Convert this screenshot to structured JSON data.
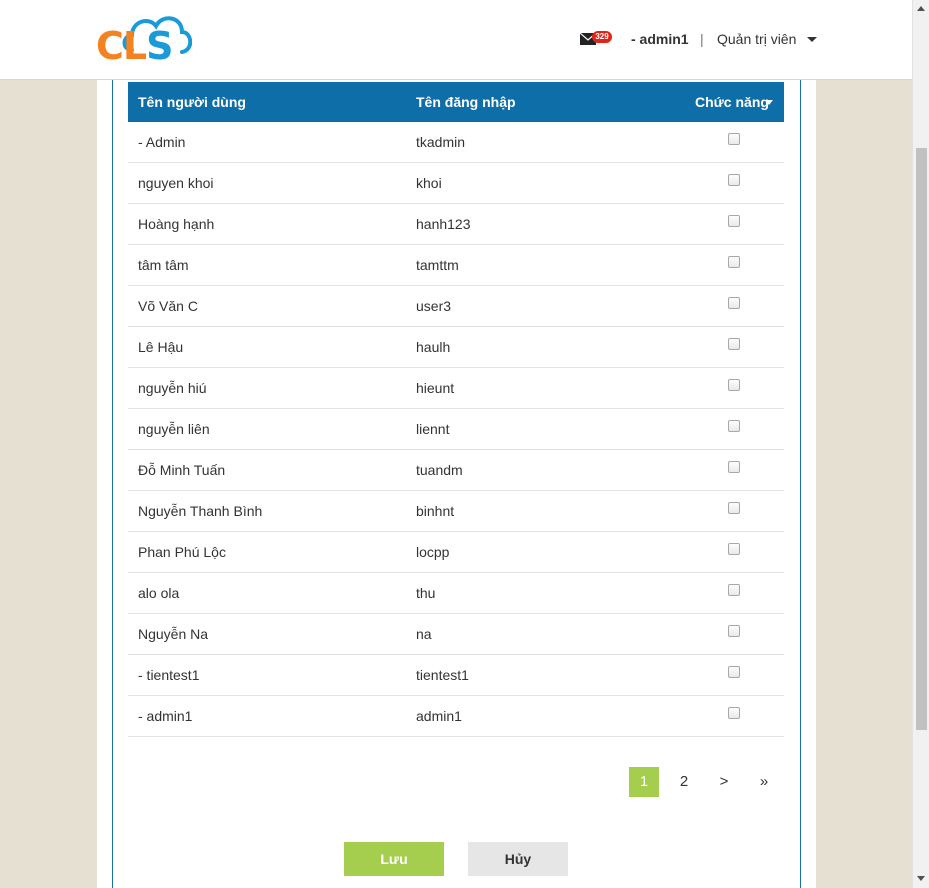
{
  "header": {
    "logo_text_main": "CL",
    "logo_text_accent": "S",
    "mail_icon": "envelope-icon",
    "mail_count": "329",
    "user_name": "- admin1",
    "separator": "|",
    "role": "Quản trị viên"
  },
  "table": {
    "columns": [
      "Tên người dùng",
      "Tên đăng nhập",
      "Chức năng"
    ],
    "rows": [
      {
        "name": "- Admin",
        "login": "tkadmin"
      },
      {
        "name": "nguyen khoi",
        "login": "khoi"
      },
      {
        "name": "Hoàng hạnh",
        "login": "hanh123"
      },
      {
        "name": "tâm tâm",
        "login": "tamttm"
      },
      {
        "name": "Võ Văn C",
        "login": "user3"
      },
      {
        "name": "Lê Hậu",
        "login": "haulh"
      },
      {
        "name": "nguyễn hiú",
        "login": "hieunt"
      },
      {
        "name": "nguyễn liên",
        "login": "liennt"
      },
      {
        "name": "Đỗ Minh Tuấn",
        "login": "tuandm"
      },
      {
        "name": "Nguyễn Thanh Bình",
        "login": "binhnt"
      },
      {
        "name": "Phan Phú Lộc",
        "login": "locpp"
      },
      {
        "name": "alo ola",
        "login": "thu"
      },
      {
        "name": "Nguyễn Na",
        "login": "na"
      },
      {
        "name": "- tientest1",
        "login": "tientest1"
      },
      {
        "name": "- admin1",
        "login": "admin1"
      }
    ]
  },
  "pagination": {
    "pages": [
      "1",
      "2",
      ">",
      "»"
    ],
    "current": "1"
  },
  "actions": {
    "save_label": "Lưu",
    "cancel_label": "Hủy"
  },
  "colors": {
    "header_blue": "#0e6fa8",
    "accent_green": "#a6ce4e",
    "logo_orange": "#f58220",
    "logo_blue": "#1a9ad6",
    "badge_red": "#e2231a"
  }
}
